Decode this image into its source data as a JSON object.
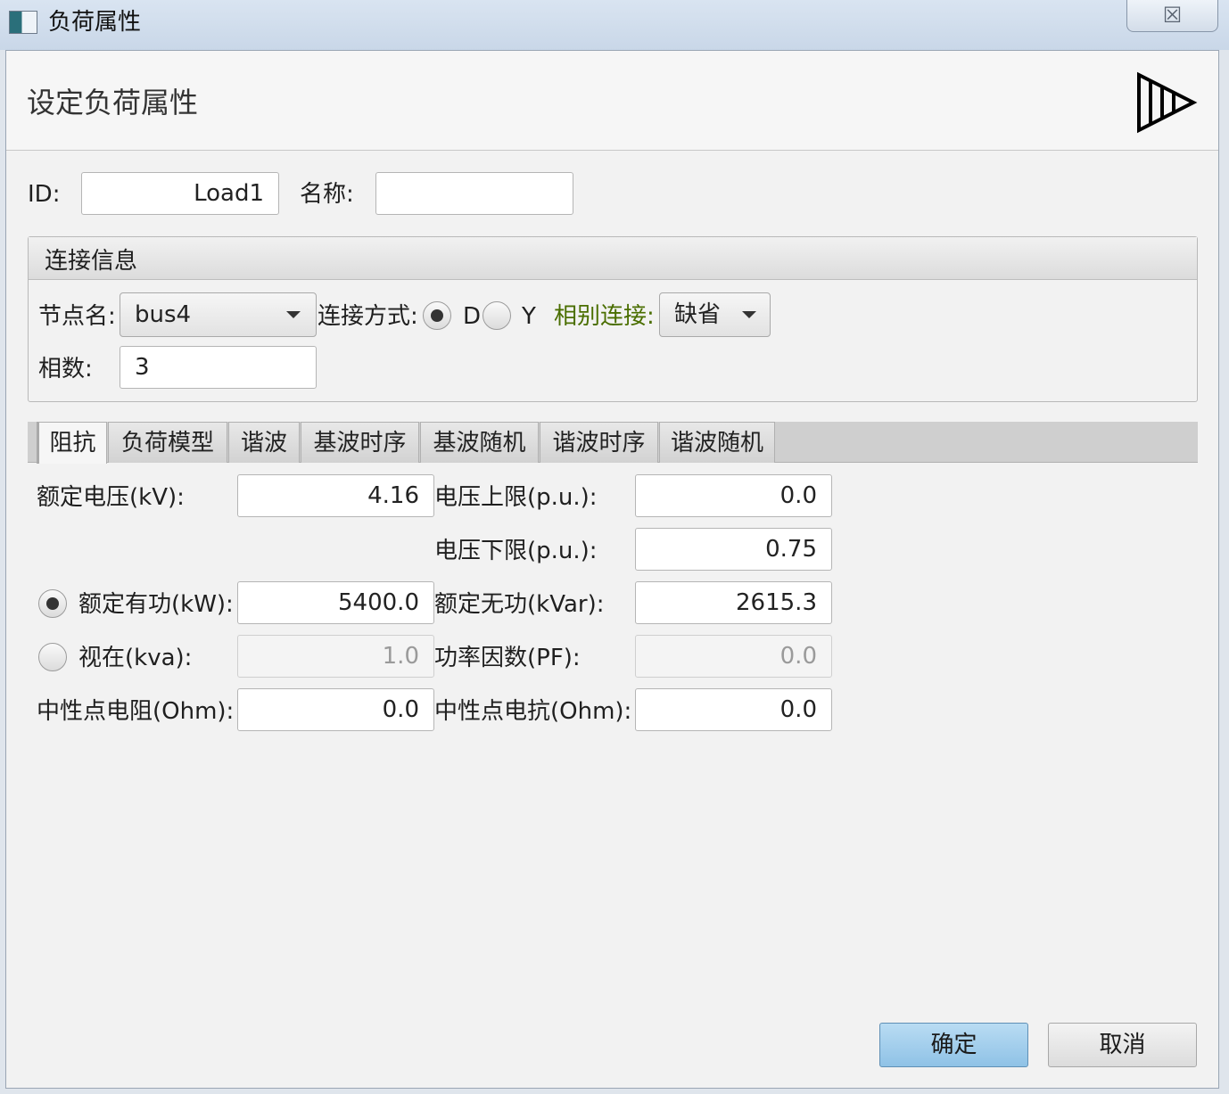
{
  "window": {
    "title": "负荷属性",
    "close_label": "☒"
  },
  "header": {
    "title": "设定负荷属性"
  },
  "basic": {
    "id_label": "ID:",
    "id_value": "Load1",
    "name_label": "名称:",
    "name_value": ""
  },
  "connection": {
    "group_title": "连接信息",
    "node_label": "节点名:",
    "node_value": "bus4",
    "mode_label": "连接方式:",
    "mode_options": [
      "D",
      "Y"
    ],
    "mode_selected": "D",
    "phase_conn_label": "相别连接:",
    "phase_conn_value": "缺省",
    "phases_label": "相数:",
    "phases_value": "3"
  },
  "tabs": [
    "阻抗",
    "负荷模型",
    "谐波",
    "基波时序",
    "基波随机",
    "谐波时序",
    "谐波随机"
  ],
  "active_tab": "阻抗",
  "impedance": {
    "rated_voltage_label": "额定电压(kV):",
    "rated_voltage": "4.16",
    "vmax_label": "电压上限(p.u.):",
    "vmax": "0.0",
    "vmin_label": "电压下限(p.u.):",
    "vmin": "0.75",
    "rated_p_label": "额定有功(kW):",
    "rated_p": "5400.0",
    "rated_q_label": "额定无功(kVar):",
    "rated_q": "2615.3",
    "apparent_label": "视在(kva):",
    "apparent": "1.0",
    "pf_label": "功率因数(PF):",
    "pf": "0.0",
    "neutral_r_label": "中性点电阻(Ohm):",
    "neutral_r": "0.0",
    "neutral_x_label": "中性点电抗(Ohm):",
    "neutral_x": "0.0",
    "power_mode_selected": "rated_power"
  },
  "footer": {
    "ok_label": "确定",
    "cancel_label": "取消"
  },
  "colors": {
    "accent": "#8fc2e6",
    "phase_label": "#4a6e00"
  }
}
